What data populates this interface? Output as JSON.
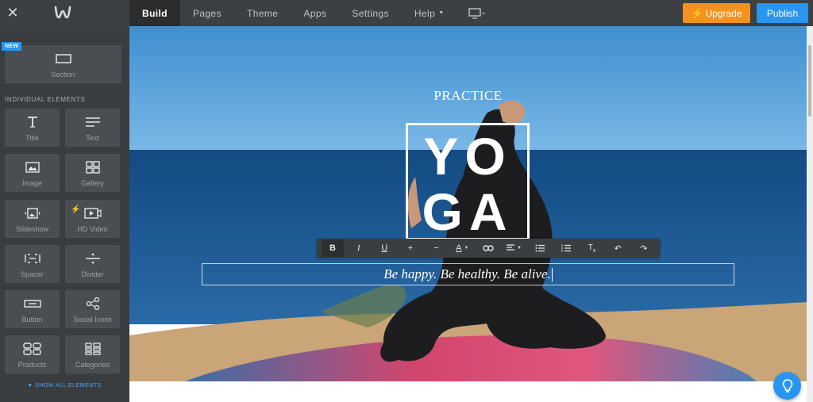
{
  "topbar": {
    "tabs": [
      {
        "label": "Build",
        "active": true
      },
      {
        "label": "Pages"
      },
      {
        "label": "Theme"
      },
      {
        "label": "Apps"
      },
      {
        "label": "Settings"
      },
      {
        "label": "Help",
        "dropdown": true
      }
    ],
    "upgrade_label": "Upgrade",
    "publish_label": "Publish",
    "icons": {
      "close": "close-icon",
      "logo": "weebly-logo-icon",
      "device": "desktop-icon",
      "upgrade": "lightning-icon"
    }
  },
  "sidebar": {
    "new_badge": "NEW",
    "section_label": "Section",
    "elements_header": "INDIVIDUAL ELEMENTS",
    "elements": [
      {
        "label": "Title",
        "icon": "title-icon"
      },
      {
        "label": "Text",
        "icon": "text-icon"
      },
      {
        "label": "Image",
        "icon": "image-icon"
      },
      {
        "label": "Gallery",
        "icon": "gallery-icon"
      },
      {
        "label": "Slideshow",
        "icon": "slideshow-icon"
      },
      {
        "label": "HD Video",
        "icon": "video-icon",
        "premium": true
      },
      {
        "label": "Spacer",
        "icon": "spacer-icon"
      },
      {
        "label": "Divider",
        "icon": "divider-icon"
      },
      {
        "label": "Button",
        "icon": "button-icon"
      },
      {
        "label": "Social Icons",
        "icon": "share-icon"
      },
      {
        "label": "Products",
        "icon": "products-icon"
      },
      {
        "label": "Categories",
        "icon": "categories-icon"
      }
    ],
    "show_all": "SHOW ALL ELEMENTS"
  },
  "hero": {
    "subtitle": "PRACTICE",
    "title_line1": "YO",
    "title_line2": "GA",
    "tagline": "Be happy. Be healthy. Be alive."
  },
  "toolbar": {
    "items": [
      "bold",
      "italic",
      "underline",
      "increase-size",
      "decrease-size",
      "text-color",
      "link",
      "align",
      "bullet-list",
      "numbered-list",
      "clear-format",
      "undo",
      "redo"
    ]
  },
  "colors": {
    "topbar_bg": "#3d4043",
    "sidebar_bg": "#3a3d40",
    "upgrade": "#f5921e",
    "publish": "#2895f1",
    "sky": "#4b9ad6",
    "sea": "#1b5a93"
  }
}
